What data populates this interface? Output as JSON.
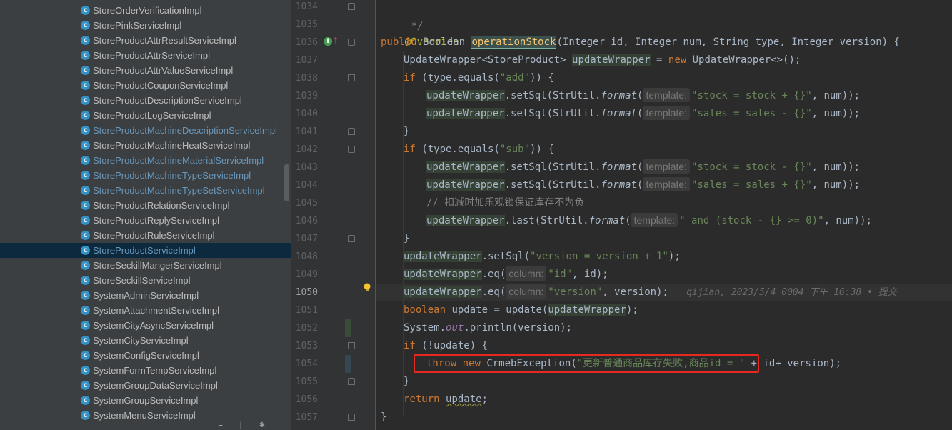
{
  "project_tree": {
    "items": [
      {
        "label": "StoreOrderVerificationImpl",
        "modified": false,
        "selected": false
      },
      {
        "label": "StorePinkServiceImpl",
        "modified": false,
        "selected": false
      },
      {
        "label": "StoreProductAttrResultServiceImpl",
        "modified": false,
        "selected": false
      },
      {
        "label": "StoreProductAttrServiceImpl",
        "modified": false,
        "selected": false
      },
      {
        "label": "StoreProductAttrValueServiceImpl",
        "modified": false,
        "selected": false
      },
      {
        "label": "StoreProductCouponServiceImpl",
        "modified": false,
        "selected": false
      },
      {
        "label": "StoreProductDescriptionServiceImpl",
        "modified": false,
        "selected": false
      },
      {
        "label": "StoreProductLogServiceImpl",
        "modified": false,
        "selected": false
      },
      {
        "label": "StoreProductMachineDescriptionServiceImpl",
        "modified": true,
        "selected": false
      },
      {
        "label": "StoreProductMachineHeatServiceImpl",
        "modified": false,
        "selected": false
      },
      {
        "label": "StoreProductMachineMaterialServiceImpl",
        "modified": true,
        "selected": false
      },
      {
        "label": "StoreProductMachineTypeServiceImpl",
        "modified": true,
        "selected": false
      },
      {
        "label": "StoreProductMachineTypeSetServiceImpl",
        "modified": true,
        "selected": false
      },
      {
        "label": "StoreProductRelationServiceImpl",
        "modified": false,
        "selected": false
      },
      {
        "label": "StoreProductReplyServiceImpl",
        "modified": false,
        "selected": false
      },
      {
        "label": "StoreProductRuleServiceImpl",
        "modified": false,
        "selected": false
      },
      {
        "label": "StoreProductServiceImpl",
        "modified": true,
        "selected": true
      },
      {
        "label": "StoreSeckillMangerServiceImpl",
        "modified": false,
        "selected": false
      },
      {
        "label": "StoreSeckillServiceImpl",
        "modified": false,
        "selected": false
      },
      {
        "label": "SystemAdminServiceImpl",
        "modified": false,
        "selected": false
      },
      {
        "label": "SystemAttachmentServiceImpl",
        "modified": false,
        "selected": false
      },
      {
        "label": "SystemCityAsyncServiceImpl",
        "modified": false,
        "selected": false
      },
      {
        "label": "SystemCityServiceImpl",
        "modified": false,
        "selected": false
      },
      {
        "label": "SystemConfigServiceImpl",
        "modified": false,
        "selected": false
      },
      {
        "label": "SystemFormTempServiceImpl",
        "modified": false,
        "selected": false
      },
      {
        "label": "SystemGroupDataServiceImpl",
        "modified": false,
        "selected": false
      },
      {
        "label": "SystemGroupServiceImpl",
        "modified": false,
        "selected": false
      },
      {
        "label": "SystemMenuServiceImpl",
        "modified": false,
        "selected": false
      }
    ],
    "class_icon_letter": "c"
  },
  "editor": {
    "line_numbers": [
      "1034",
      "1035",
      "1036",
      "1037",
      "1038",
      "1039",
      "1040",
      "1041",
      "1042",
      "1043",
      "1044",
      "1045",
      "1046",
      "1047",
      "1048",
      "1049",
      "1050",
      "1051",
      "1052",
      "1053",
      "1054",
      "1055",
      "1056",
      "1057"
    ],
    "current_line": "1050",
    "override_icon": "I",
    "code": {
      "l1034": "*/",
      "l1035_annotation": "@Override",
      "l1036_kw_public": "public",
      "l1036_type": "Boolean",
      "l1036_method": "operationStock",
      "l1036_params_a": "(Integer id, Integer num, String type, Integer version) {",
      "l1037_type": "UpdateWrapper<StoreProduct>",
      "l1037_var": "updateWrapper",
      "l1037_eq": " = ",
      "l1037_new": "new",
      "l1037_rest": " UpdateWrapper<>();",
      "l1038_if": "if",
      "l1038_a": " (type.equals(",
      "l1038_str": "\"add\"",
      "l1038_b": ")) {",
      "hint_template": "template:",
      "hint_column": "column:",
      "var": "updateWrapper",
      "set_sql": ".setSql(StrUtil.",
      "format": "format",
      "open_paren": "(",
      "l1039_str": "\"stock = stock + {}\"",
      "l1040_str": "\"sales = sales - {}\"",
      "num_tail": ", num));",
      "close_brace": "}",
      "l1042_str": "\"sub\"",
      "l1043_str": "\"stock = stock - {}\"",
      "l1044_str": "\"sales = sales + {}\"",
      "l1045_comment": "// 扣减时加乐观锁保证库存不为负",
      "l1046_last": ".last(StrUtil.",
      "l1046_str": "\" and (stock - {} >= 0)\"",
      "l1048_a": ".setSql(",
      "l1048_str": "\"version = version + 1\"",
      "l1048_b": ");",
      "l1049_a": ".eq(",
      "l1049_str": "\"id\"",
      "l1049_b": ", id);",
      "l1050_str": "\"version\"",
      "l1050_b": ", version);",
      "l1050_blame": "qijian, 2023/5/4 0004 下午 16:38 • 提交",
      "l1051_kw": "boolean",
      "l1051_a": " update = update(",
      "l1051_b": ");",
      "l1052_a": "System.",
      "l1052_out": "out",
      "l1052_b": ".println(version);",
      "l1053_if": "if",
      "l1053_a": " (!update) {",
      "l1054_throw": "throw",
      "l1054_new": "new",
      "l1054_a": " CrmebException(",
      "l1054_str": "\"更新普通商品库存失败,商品id = \"",
      "l1054_b": " + id+ version);",
      "l1056_return": "return",
      "l1056_var": "update",
      "l1056_b": ";"
    }
  },
  "colors": {
    "keyword": "#cc7832",
    "string": "#6a8759",
    "annotation": "#bbb529",
    "method_decl": "#ffc66d",
    "highlight_box": "#e6291f"
  }
}
